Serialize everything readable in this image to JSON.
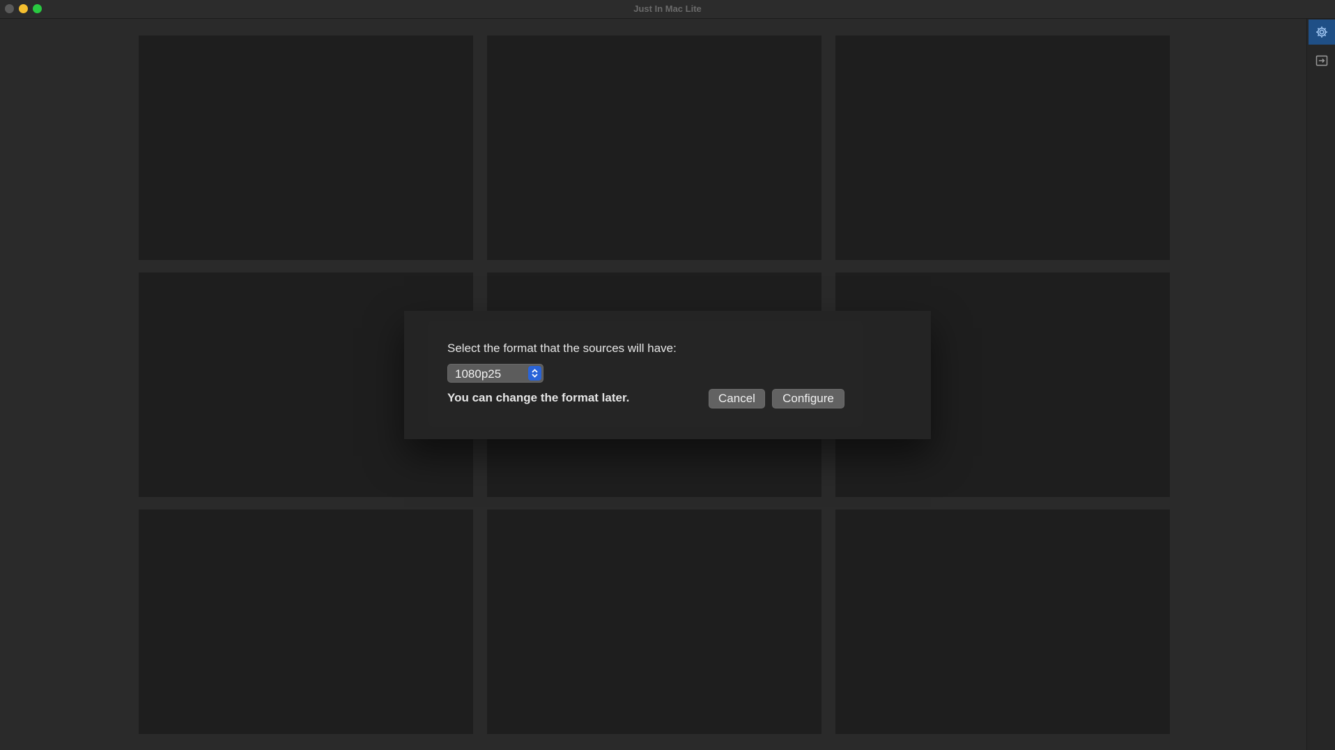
{
  "window": {
    "title": "Just In Mac Lite"
  },
  "sidebar": {
    "buttons": [
      {
        "icon": "gear-icon"
      },
      {
        "icon": "exit-icon"
      }
    ],
    "accent_color": "#1f4f86"
  },
  "dialog": {
    "prompt": "Select the format that the sources will have:",
    "format_select": {
      "value": "1080p25"
    },
    "note": "You can change the format later.",
    "cancel_label": "Cancel",
    "configure_label": "Configure"
  },
  "grid": {
    "rows": 3,
    "columns": 3
  }
}
